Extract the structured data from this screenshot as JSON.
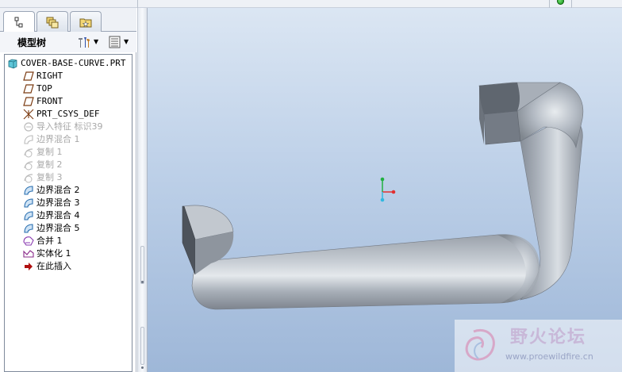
{
  "left_panel": {
    "tabs": [
      {
        "icon": "model-tree-icon",
        "active": true
      },
      {
        "icon": "folder-browser-icon",
        "active": false
      },
      {
        "icon": "favorites-icon",
        "active": false
      }
    ],
    "tree_header": {
      "title": "模型树",
      "settings_icon": "tree-settings-icon",
      "show_icon": "tree-show-icon"
    },
    "tree": {
      "root": "COVER-BASE-CURVE.PRT",
      "items": [
        {
          "label": "RIGHT",
          "icon": "datum-plane-icon",
          "suppressed": false
        },
        {
          "label": "TOP",
          "icon": "datum-plane-icon",
          "suppressed": false
        },
        {
          "label": "FRONT",
          "icon": "datum-plane-icon",
          "suppressed": false
        },
        {
          "label": "PRT_CSYS_DEF",
          "icon": "coordinate-system-icon",
          "suppressed": false
        },
        {
          "label": "导入特征 标识39",
          "icon": "import-feature-icon",
          "suppressed": true
        },
        {
          "label": "边界混合 1",
          "icon": "boundary-blend-icon",
          "suppressed": true
        },
        {
          "label": "复制 1",
          "icon": "copy-icon",
          "suppressed": true
        },
        {
          "label": "复制 2",
          "icon": "copy-icon",
          "suppressed": true
        },
        {
          "label": "复制 3",
          "icon": "copy-icon",
          "suppressed": true
        },
        {
          "label": "边界混合 2",
          "icon": "boundary-blend-icon",
          "suppressed": false
        },
        {
          "label": "边界混合 3",
          "icon": "boundary-blend-icon",
          "suppressed": false
        },
        {
          "label": "边界混合 4",
          "icon": "boundary-blend-icon",
          "suppressed": false
        },
        {
          "label": "边界混合 5",
          "icon": "boundary-blend-icon",
          "suppressed": false
        },
        {
          "label": "合并 1",
          "icon": "merge-icon",
          "suppressed": false
        },
        {
          "label": "实体化 1",
          "icon": "solidify-icon",
          "suppressed": false
        },
        {
          "label": "在此插入",
          "icon": "insert-here-arrow-icon",
          "suppressed": false
        }
      ]
    }
  },
  "viewport": {
    "model_color": "#a7adb6",
    "background_top": "#dbe6f3",
    "background_bottom": "#9eb7d8"
  },
  "watermark": {
    "title": "野火论坛",
    "url": "www.proewildfire.cn"
  },
  "colors": {
    "status_light": "#1ea31e",
    "insert_arrow": "#b01010",
    "axis_x": "#e23030",
    "axis_y": "#20b040",
    "axis_z": "#30b8e0"
  }
}
